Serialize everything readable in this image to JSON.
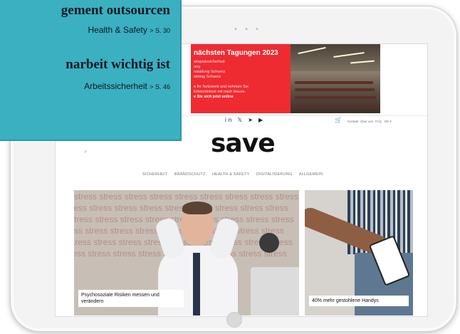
{
  "teaser": {
    "items": [
      {
        "headline": "gement outsourcen",
        "category": "Health & Safety",
        "page": "> S. 30"
      },
      {
        "headline": "narbeit wichtig ist",
        "category": "Arbeitssicherheit",
        "page": "> S. 46"
      }
    ]
  },
  "banner": {
    "title": "nächsten Tagungen 2023",
    "lines": [
      "eitsplatzsicherheit",
      "ung",
      "nstaltung Schweiz",
      "eitstag Schweiz",
      "",
      "e Ihr Netzwerk und nehmen Sie",
      "Erkenntnisse mit nach Hause.",
      "e Sie sich jetzt online"
    ]
  },
  "header": {
    "social_icons": "in 𝕏 ➤ ▶",
    "utility_links": [
      "Kontakt",
      "Über uns",
      "FAQ",
      "DE ▾"
    ],
    "logo": "save"
  },
  "nav": {
    "items": [
      "SICHERHEIT",
      "BRANDSCHUTZ",
      "HEALTH & SAFETY",
      "DIGITALISIERUNG",
      "ALLGEMEIN"
    ]
  },
  "articles": [
    {
      "title": "Psychosoziale Risiken messen und verändern",
      "background_text": "stress stress stress stress stress stress stress stress stress"
    },
    {
      "title": "40% mehr gestohlene Handys"
    }
  ],
  "colors": {
    "teaser_bg": "#3ab0c1",
    "banner_red": "#ef2b32"
  }
}
